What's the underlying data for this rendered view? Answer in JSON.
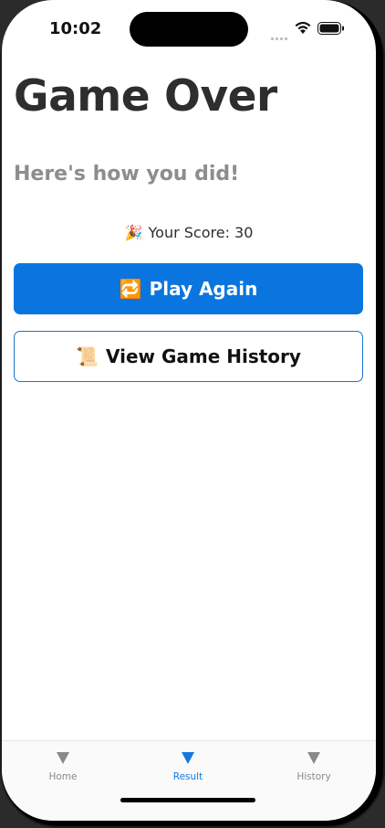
{
  "status_bar": {
    "time": "10:02"
  },
  "content": {
    "title": "Game Over",
    "subtitle": "Here's how you did!",
    "score_emoji": "🎉",
    "score_text": "Your Score: 30",
    "play_again": {
      "emoji": "🔁",
      "label": "Play Again"
    },
    "view_history": {
      "emoji": "📜",
      "label": "View Game History"
    }
  },
  "tab_bar": {
    "tabs": [
      {
        "label": "Home",
        "icon": "triangle-down-icon",
        "active": false
      },
      {
        "label": "Result",
        "icon": "triangle-down-icon",
        "active": true
      },
      {
        "label": "History",
        "icon": "triangle-down-icon",
        "active": false
      }
    ]
  },
  "colors": {
    "accent": "#0a75de",
    "title": "#2e2e2e",
    "subtitle": "#8d8d8d",
    "tab_inactive": "#8a8a8a",
    "tab_active": "#1379e0"
  }
}
